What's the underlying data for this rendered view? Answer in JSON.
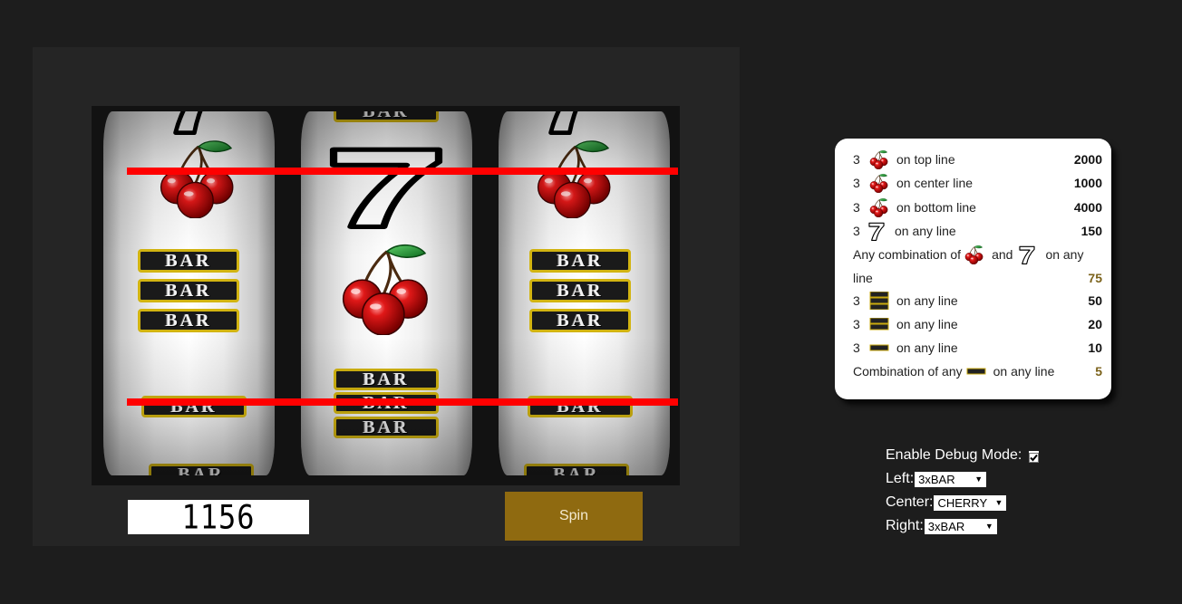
{
  "machine": {
    "credits": "1156",
    "spin_label": "Spin",
    "reels": [
      {
        "name": "left",
        "visible": [
          "seven",
          "cherry",
          "3xBAR",
          "1xBAR",
          "1xBAR"
        ]
      },
      {
        "name": "center",
        "visible": [
          "2xBAR",
          "seven",
          "cherry",
          "3xBAR"
        ]
      },
      {
        "name": "right",
        "visible": [
          "seven",
          "cherry",
          "3xBAR",
          "1xBAR",
          "1xBAR"
        ]
      }
    ],
    "paylines": [
      "top",
      "bottom"
    ],
    "payline_color": "#ff0000"
  },
  "paytable": {
    "rows": [
      {
        "count": "3",
        "icon": "cherry-icon",
        "text": "on top line",
        "value": "2000"
      },
      {
        "count": "3",
        "icon": "cherry-icon",
        "text": "on center line",
        "value": "1000"
      },
      {
        "count": "3",
        "icon": "cherry-icon",
        "text": "on bottom line",
        "value": "4000"
      },
      {
        "count": "3",
        "icon": "seven-icon",
        "text": "on any line",
        "value": "150"
      },
      {
        "prefix": "Any combination of",
        "and": "and",
        "suffix": "on any",
        "wrap": "line",
        "value": "75"
      },
      {
        "count": "3",
        "icon": "3xbar-icon",
        "text": "on any line",
        "value": "50"
      },
      {
        "count": "3",
        "icon": "2xbar-icon",
        "text": "on any line",
        "value": "20"
      },
      {
        "count": "3",
        "icon": "1xbar-icon",
        "text": "on any line",
        "value": "10"
      },
      {
        "prefix": "Combination of any",
        "icon": "1xbar-icon",
        "text": "on any line",
        "value": "5"
      }
    ]
  },
  "debug": {
    "enable_label": "Enable Debug Mode:",
    "enabled": true,
    "left_label": "Left:",
    "left_value": "3xBAR",
    "center_label": "Center:",
    "center_value": "CHERRY",
    "right_label": "Right:",
    "right_value": "3xBAR"
  },
  "colors": {
    "background": "#1d1d1d",
    "machine_bg": "#252525",
    "spin_button": "#8f6a10",
    "bar_border": "#d2b411",
    "gold_value": "#7b621b"
  }
}
